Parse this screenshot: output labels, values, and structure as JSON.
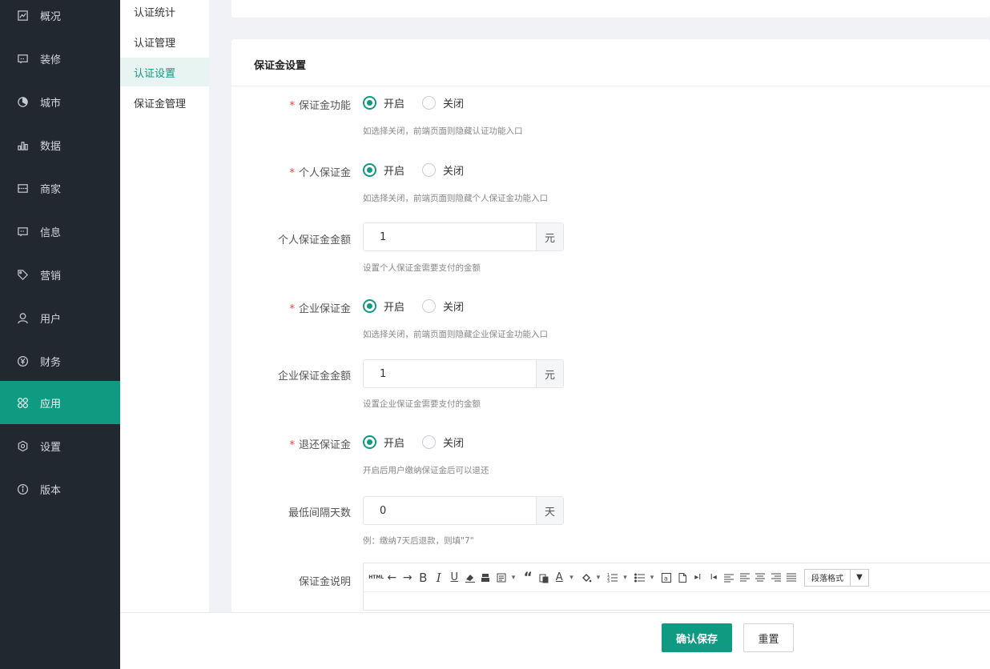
{
  "sidebar": {
    "items": [
      {
        "label": "概况",
        "icon": "overview-icon",
        "active": false
      },
      {
        "label": "装修",
        "icon": "decorate-icon",
        "active": false
      },
      {
        "label": "城市",
        "icon": "city-icon",
        "active": false
      },
      {
        "label": "数据",
        "icon": "data-icon",
        "active": false
      },
      {
        "label": "商家",
        "icon": "merchant-icon",
        "active": false
      },
      {
        "label": "信息",
        "icon": "message-icon",
        "active": false
      },
      {
        "label": "营销",
        "icon": "tag-icon",
        "active": false
      },
      {
        "label": "用户",
        "icon": "user-icon",
        "active": false
      },
      {
        "label": "财务",
        "icon": "yen-icon",
        "active": false
      },
      {
        "label": "应用",
        "icon": "apps-icon",
        "active": true
      },
      {
        "label": "设置",
        "icon": "settings-icon",
        "active": false
      },
      {
        "label": "版本",
        "icon": "info-icon",
        "active": false
      }
    ],
    "accent": "#0f9a82"
  },
  "submenu": {
    "items": [
      {
        "label": "认证统计",
        "active": false
      },
      {
        "label": "认证管理",
        "active": false
      },
      {
        "label": "认证设置",
        "active": true
      },
      {
        "label": "保证金管理",
        "active": false
      }
    ]
  },
  "card": {
    "title": "保证金设置"
  },
  "form": {
    "deposit_function": {
      "label": "保证金功能",
      "on": "开启",
      "off": "关闭",
      "selected": "on",
      "hint": "如选择关闭，前端页面则隐藏认证功能入口"
    },
    "personal_deposit": {
      "label": "个人保证金",
      "on": "开启",
      "off": "关闭",
      "selected": "on",
      "hint": "如选择关闭，前端页面则隐藏个人保证金功能入口"
    },
    "personal_amount": {
      "label": "个人保证金金额",
      "value": "1",
      "unit": "元",
      "hint": "设置个人保证金需要支付的金额"
    },
    "enterprise_deposit": {
      "label": "企业保证金",
      "on": "开启",
      "off": "关闭",
      "selected": "on",
      "hint": "如选择关闭，前端页面则隐藏企业保证金功能入口"
    },
    "enterprise_amount": {
      "label": "企业保证金金额",
      "value": "1",
      "unit": "元",
      "hint": "设置企业保证金需要支付的金额"
    },
    "refund_deposit": {
      "label": "退还保证金",
      "on": "开启",
      "off": "关闭",
      "selected": "on",
      "hint": "开启后用户缴纳保证金后可以退还"
    },
    "min_interval": {
      "label": "最低间隔天数",
      "value": "0",
      "unit": "天",
      "hint": "例：缴纳7天后退款，则填\"7\""
    },
    "description": {
      "label": "保证金说明",
      "html_label": "HTML",
      "paragraph_format": "段落格式"
    }
  },
  "footer": {
    "save_label": "确认保存",
    "reset_label": "重置"
  }
}
